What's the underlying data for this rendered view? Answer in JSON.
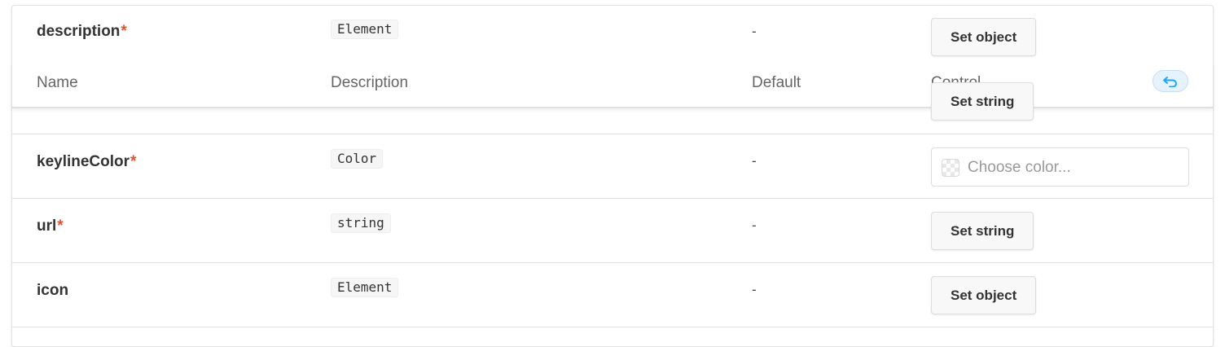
{
  "header": {
    "name": "Name",
    "description": "Description",
    "default": "Default",
    "control": "Control"
  },
  "required_mark": "*",
  "rows": [
    {
      "name": "description",
      "required": true,
      "type": "Element",
      "default": "-",
      "control_label": "Set object"
    },
    {
      "name": "",
      "required": false,
      "type": "",
      "default": "",
      "control_label": "Set string"
    },
    {
      "name": "keylineColor",
      "required": true,
      "type": "Color",
      "default": "-",
      "control_placeholder": "Choose color..."
    },
    {
      "name": "url",
      "required": true,
      "type": "string",
      "default": "-",
      "control_label": "Set string"
    },
    {
      "name": "icon",
      "required": false,
      "type": "Element",
      "default": "-",
      "control_label": "Set object"
    }
  ],
  "icons": {
    "undo": "undo-icon",
    "color_swatch": "transparent-swatch-icon"
  },
  "colors": {
    "required": "#e2502a",
    "undo_bg": "#e6f2fd",
    "undo_icon": "#1ea7fd"
  }
}
